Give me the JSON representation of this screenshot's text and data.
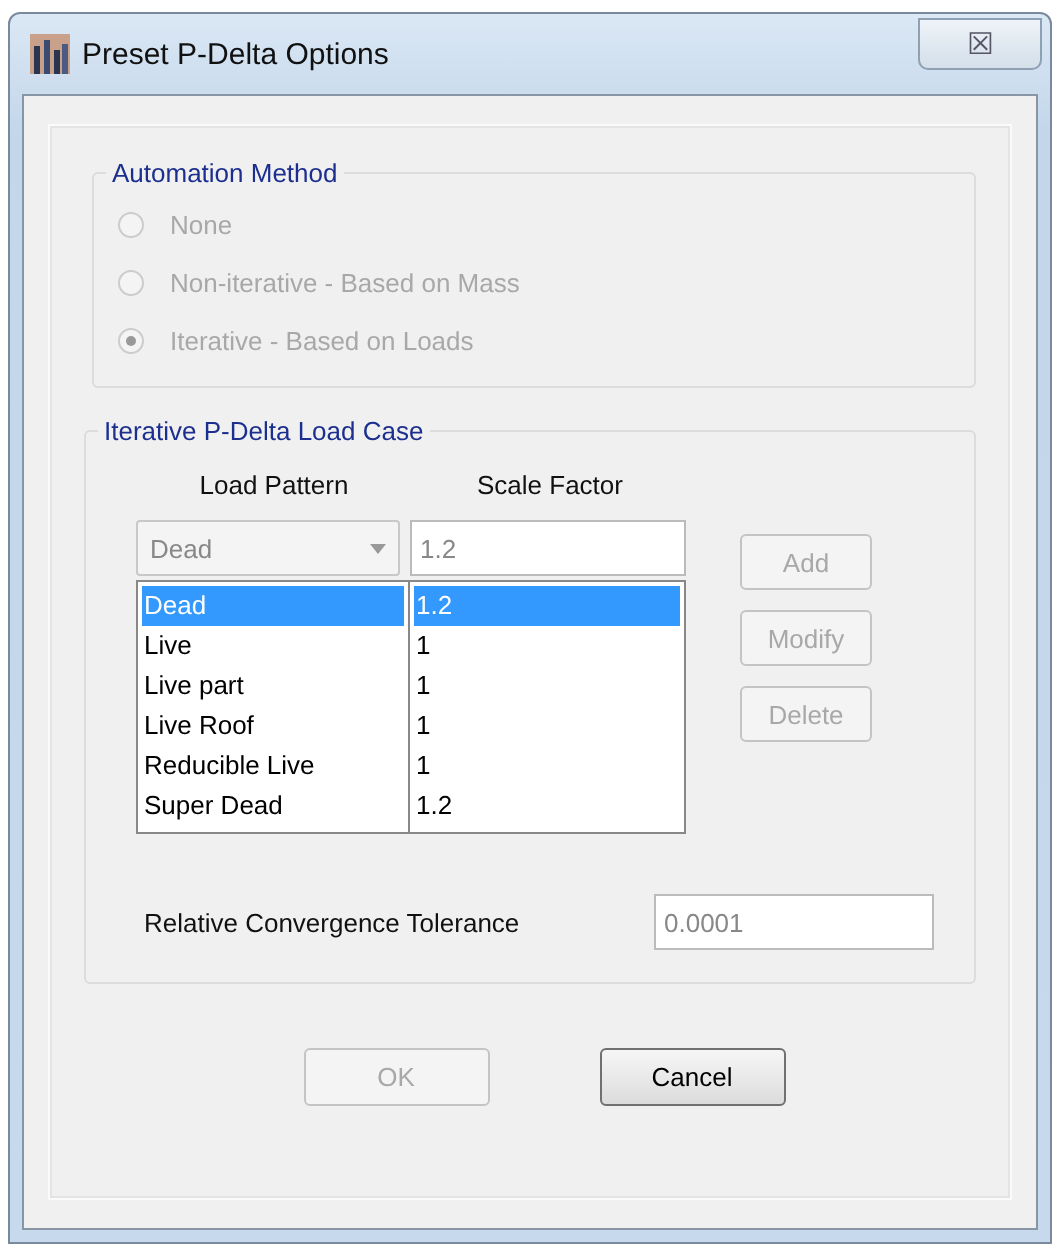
{
  "window": {
    "title": "Preset P-Delta Options",
    "close": "☒"
  },
  "automation_method": {
    "title": "Automation Method",
    "options": [
      {
        "label": "None",
        "selected": false,
        "disabled": true
      },
      {
        "label": "Non-iterative - Based on Mass",
        "selected": false,
        "disabled": true
      },
      {
        "label": "Iterative - Based on Loads",
        "selected": true,
        "disabled": true
      }
    ]
  },
  "load_case": {
    "title": "Iterative P-Delta Load Case",
    "columns": [
      "Load Pattern",
      "Scale Factor"
    ],
    "pattern_value": "Dead",
    "scale_value": "1.2",
    "rows": [
      {
        "pattern": "Dead",
        "scale": "1.2",
        "selected": true
      },
      {
        "pattern": "Live",
        "scale": "1",
        "selected": false
      },
      {
        "pattern": "Live part",
        "scale": "1",
        "selected": false
      },
      {
        "pattern": "Live Roof",
        "scale": "1",
        "selected": false
      },
      {
        "pattern": "Reducible Live",
        "scale": "1",
        "selected": false
      },
      {
        "pattern": "Super Dead",
        "scale": "1.2",
        "selected": false
      }
    ],
    "buttons": [
      {
        "label": "Add",
        "disabled": true
      },
      {
        "label": "Modify",
        "disabled": true
      },
      {
        "label": "Delete",
        "disabled": true
      }
    ],
    "tolerance": {
      "label": "Relative Convergence Tolerance",
      "value": "0.0001"
    }
  },
  "buttons": [
    {
      "label": "OK",
      "disabled": true
    },
    {
      "label": "Cancel",
      "disabled": false
    }
  ]
}
